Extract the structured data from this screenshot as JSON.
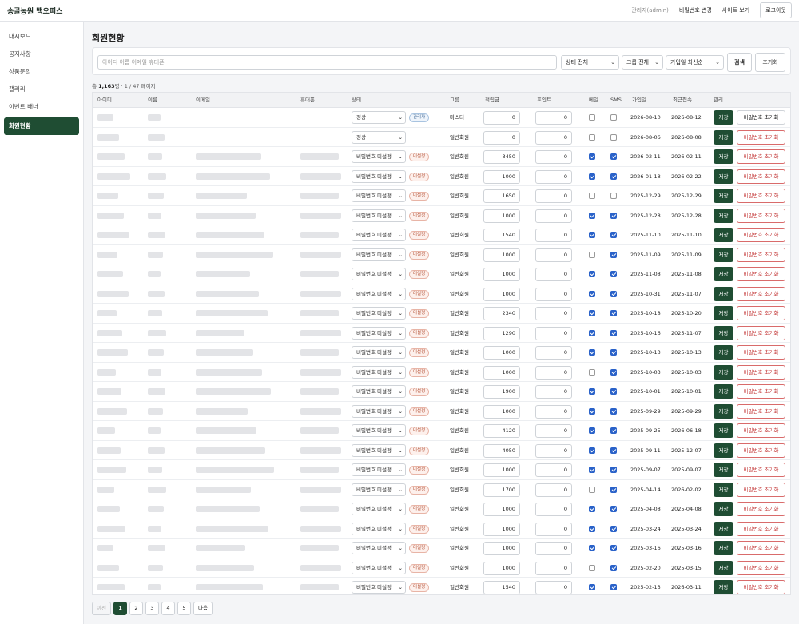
{
  "app": {
    "brand": "송골농원 백오피스",
    "admin_label": "관리자(admin)",
    "change_password": "비밀번호 변경",
    "view_site": "사이트 보기",
    "logout": "로그아웃"
  },
  "sidebar": {
    "items": [
      {
        "label": "대시보드",
        "active": false
      },
      {
        "label": "공지사항",
        "active": false
      },
      {
        "label": "상품문의",
        "active": false
      },
      {
        "label": "갤러리",
        "active": false
      },
      {
        "label": "이벤트 배너",
        "active": false
      },
      {
        "label": "회원현황",
        "active": true
      }
    ]
  },
  "page": {
    "title": "회원현황"
  },
  "search": {
    "placeholder": "아이디·이름·이메일·휴대폰",
    "status_filter": "상태 전체",
    "group_filter": "그룹 전체",
    "sort": "가입일 최신순",
    "search_button": "검색",
    "reset_button": "초기화"
  },
  "summary": {
    "prefix": "총",
    "count": "1,163",
    "rest": "명 · 1 / 47 페이지"
  },
  "table": {
    "headers": [
      "아이디",
      "이름",
      "이메일",
      "휴대폰",
      "상태",
      "그룹",
      "적립금",
      "포인트",
      "메일",
      "SMS",
      "가입일",
      "최근접속",
      "관리"
    ],
    "save_label": "저장",
    "reset_label": "비밀번호 초기화",
    "rows": [
      {
        "status": "정상",
        "badge": "관리자",
        "badge_type": "admin",
        "group": "마스터",
        "reserve": "0",
        "points": "0",
        "mail": false,
        "sms": false,
        "joined": "2026-08-10",
        "last": "2026-08-12",
        "plain_reset": true
      },
      {
        "status": "정상",
        "badge": "",
        "badge_type": "",
        "group": "일반회원",
        "reserve": "0",
        "points": "0",
        "mail": false,
        "sms": false,
        "joined": "2026-08-06",
        "last": "2026-08-08",
        "plain_reset": false
      },
      {
        "status": "비밀번호 미설정",
        "badge": "미설정",
        "badge_type": "warn",
        "group": "일반회원",
        "reserve": "3450",
        "points": "0",
        "mail": true,
        "sms": true,
        "joined": "2026-02-11",
        "last": "2026-02-11",
        "plain_reset": false
      },
      {
        "status": "비밀번호 미설정",
        "badge": "미설정",
        "badge_type": "warn",
        "group": "일반회원",
        "reserve": "1000",
        "points": "0",
        "mail": true,
        "sms": true,
        "joined": "2026-01-18",
        "last": "2026-02-22",
        "plain_reset": false
      },
      {
        "status": "비밀번호 미설정",
        "badge": "미설정",
        "badge_type": "warn",
        "group": "일반회원",
        "reserve": "1650",
        "points": "0",
        "mail": false,
        "sms": false,
        "joined": "2025-12-29",
        "last": "2025-12-29",
        "plain_reset": false
      },
      {
        "status": "비밀번호 미설정",
        "badge": "미설정",
        "badge_type": "warn",
        "group": "일반회원",
        "reserve": "1000",
        "points": "0",
        "mail": true,
        "sms": true,
        "joined": "2025-12-28",
        "last": "2025-12-28",
        "plain_reset": false
      },
      {
        "status": "비밀번호 미설정",
        "badge": "미설정",
        "badge_type": "warn",
        "group": "일반회원",
        "reserve": "1540",
        "points": "0",
        "mail": true,
        "sms": true,
        "joined": "2025-11-10",
        "last": "2025-11-10",
        "plain_reset": false
      },
      {
        "status": "비밀번호 미설정",
        "badge": "미설정",
        "badge_type": "warn",
        "group": "일반회원",
        "reserve": "1000",
        "points": "0",
        "mail": false,
        "sms": true,
        "joined": "2025-11-09",
        "last": "2025-11-09",
        "plain_reset": false
      },
      {
        "status": "비밀번호 미설정",
        "badge": "미설정",
        "badge_type": "warn",
        "group": "일반회원",
        "reserve": "1000",
        "points": "0",
        "mail": true,
        "sms": true,
        "joined": "2025-11-08",
        "last": "2025-11-08",
        "plain_reset": false
      },
      {
        "status": "비밀번호 미설정",
        "badge": "미설정",
        "badge_type": "warn",
        "group": "일반회원",
        "reserve": "1000",
        "points": "0",
        "mail": true,
        "sms": true,
        "joined": "2025-10-31",
        "last": "2025-11-07",
        "plain_reset": false
      },
      {
        "status": "비밀번호 미설정",
        "badge": "미설정",
        "badge_type": "warn",
        "group": "일반회원",
        "reserve": "2340",
        "points": "0",
        "mail": true,
        "sms": true,
        "joined": "2025-10-18",
        "last": "2025-10-20",
        "plain_reset": false
      },
      {
        "status": "비밀번호 미설정",
        "badge": "미설정",
        "badge_type": "warn",
        "group": "일반회원",
        "reserve": "1290",
        "points": "0",
        "mail": true,
        "sms": true,
        "joined": "2025-10-16",
        "last": "2025-11-07",
        "plain_reset": false
      },
      {
        "status": "비밀번호 미설정",
        "badge": "미설정",
        "badge_type": "warn",
        "group": "일반회원",
        "reserve": "1000",
        "points": "0",
        "mail": true,
        "sms": true,
        "joined": "2025-10-13",
        "last": "2025-10-13",
        "plain_reset": false
      },
      {
        "status": "비밀번호 미설정",
        "badge": "미설정",
        "badge_type": "warn",
        "group": "일반회원",
        "reserve": "1000",
        "points": "0",
        "mail": false,
        "sms": true,
        "joined": "2025-10-03",
        "last": "2025-10-03",
        "plain_reset": false
      },
      {
        "status": "비밀번호 미설정",
        "badge": "미설정",
        "badge_type": "warn",
        "group": "일반회원",
        "reserve": "1900",
        "points": "0",
        "mail": true,
        "sms": true,
        "joined": "2025-10-01",
        "last": "2025-10-01",
        "plain_reset": false
      },
      {
        "status": "비밀번호 미설정",
        "badge": "미설정",
        "badge_type": "warn",
        "group": "일반회원",
        "reserve": "1000",
        "points": "0",
        "mail": true,
        "sms": true,
        "joined": "2025-09-29",
        "last": "2025-09-29",
        "plain_reset": false
      },
      {
        "status": "비밀번호 미설정",
        "badge": "미설정",
        "badge_type": "warn",
        "group": "일반회원",
        "reserve": "4120",
        "points": "0",
        "mail": true,
        "sms": true,
        "joined": "2025-09-25",
        "last": "2026-06-18",
        "plain_reset": false
      },
      {
        "status": "비밀번호 미설정",
        "badge": "미설정",
        "badge_type": "warn",
        "group": "일반회원",
        "reserve": "4050",
        "points": "0",
        "mail": true,
        "sms": true,
        "joined": "2025-09-11",
        "last": "2025-12-07",
        "plain_reset": false
      },
      {
        "status": "비밀번호 미설정",
        "badge": "미설정",
        "badge_type": "warn",
        "group": "일반회원",
        "reserve": "1000",
        "points": "0",
        "mail": true,
        "sms": true,
        "joined": "2025-09-07",
        "last": "2025-09-07",
        "plain_reset": false
      },
      {
        "status": "비밀번호 미설정",
        "badge": "미설정",
        "badge_type": "warn",
        "group": "일반회원",
        "reserve": "1700",
        "points": "0",
        "mail": false,
        "sms": true,
        "joined": "2025-04-14",
        "last": "2026-02-02",
        "plain_reset": false
      },
      {
        "status": "비밀번호 미설정",
        "badge": "미설정",
        "badge_type": "warn",
        "group": "일반회원",
        "reserve": "1000",
        "points": "0",
        "mail": true,
        "sms": true,
        "joined": "2025-04-08",
        "last": "2025-04-08",
        "plain_reset": false
      },
      {
        "status": "비밀번호 미설정",
        "badge": "미설정",
        "badge_type": "warn",
        "group": "일반회원",
        "reserve": "1000",
        "points": "0",
        "mail": true,
        "sms": true,
        "joined": "2025-03-24",
        "last": "2025-03-24",
        "plain_reset": false
      },
      {
        "status": "비밀번호 미설정",
        "badge": "미설정",
        "badge_type": "warn",
        "group": "일반회원",
        "reserve": "1000",
        "points": "0",
        "mail": true,
        "sms": true,
        "joined": "2025-03-16",
        "last": "2025-03-16",
        "plain_reset": false
      },
      {
        "status": "비밀번호 미설정",
        "badge": "미설정",
        "badge_type": "warn",
        "group": "일반회원",
        "reserve": "1000",
        "points": "0",
        "mail": false,
        "sms": true,
        "joined": "2025-02-20",
        "last": "2025-03-15",
        "plain_reset": false
      },
      {
        "status": "비밀번호 미설정",
        "badge": "미설정",
        "badge_type": "warn",
        "group": "일반회원",
        "reserve": "1540",
        "points": "0",
        "mail": true,
        "sms": true,
        "joined": "2025-02-13",
        "last": "2026-03-11",
        "plain_reset": false
      }
    ]
  },
  "pagination": {
    "prev": "이전",
    "pages": [
      "1",
      "2",
      "3",
      "4",
      "5"
    ],
    "current": "1",
    "next": "다음"
  },
  "colors": {
    "accent": "#1f4d33",
    "checkbox": "#2a62c9",
    "danger": "#c53d3d"
  }
}
